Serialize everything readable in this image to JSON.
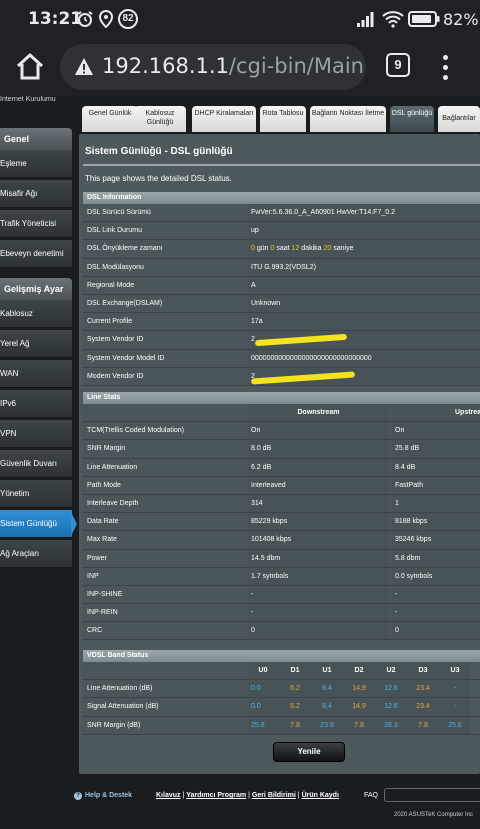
{
  "status_bar": {
    "time": "13:21",
    "notification_count": "82",
    "battery_percent": "82%"
  },
  "browser": {
    "url_host": "192.168.1.1",
    "url_path": "/cgi-bin/Main_Ac",
    "tab_count": "9"
  },
  "nav": {
    "top_text": "Internet Kurulumu",
    "section_general": "Genel",
    "general_items": [
      "Eşleme",
      "Misafir Ağı",
      "Trafik Yöneticisi",
      "Ebeveyn denetimi"
    ],
    "section_advanced": "Gelişmiş Ayar",
    "advanced_items": [
      "Kablosuz",
      "Yerel Ağ",
      "WAN",
      "IPv6",
      "VPN",
      "Güvenlik Duvarı",
      "Yönetim",
      "Sistem Günlüğü",
      "Ağ Araçları"
    ]
  },
  "tabs": [
    {
      "label": "Genel Günlük"
    },
    {
      "label": "Kablosuz Günlüğü"
    },
    {
      "label": "DHCP Kiralamaları"
    },
    {
      "label": "Rota Tablosu"
    },
    {
      "label": "Bağlantı Noktası İletme"
    },
    {
      "label": "DSL günlüğü"
    },
    {
      "label": "Bağlantılar"
    }
  ],
  "page": {
    "title": "Sistem Günlüğü - DSL günlüğü",
    "description": "This page shows the detailed DSL status."
  },
  "dsl_info": {
    "header": "DSL Information",
    "rows": [
      {
        "label": "DSL Sürücü Sürümü",
        "value": "FwVer:5.6.36.0_A_A60901 HwVer:T14.F7_0.2"
      },
      {
        "label": "DSL Link Durumu",
        "value": "up"
      },
      {
        "label": "DSL Önyükleme zamanı",
        "days": "0",
        "days_unit": "gün",
        "hours": "0",
        "hours_unit": "saat",
        "minutes": "12",
        "minutes_unit": "dakika",
        "seconds": "20",
        "seconds_unit": "saniye"
      },
      {
        "label": "DSL Modülasyonu",
        "value": "ITU G.993.2(VDSL2)"
      },
      {
        "label": "Regional Mode",
        "value": "A"
      },
      {
        "label": "DSL Exchange(DSLAM)",
        "value": "Unknown"
      },
      {
        "label": "Current Profile",
        "value": "17a"
      },
      {
        "label": "System Vendor ID",
        "value": "2"
      },
      {
        "label": "System Vendor Model ID",
        "value": "0000000000000000000000000000000"
      },
      {
        "label": "Modem Vendor ID",
        "value": "2"
      }
    ]
  },
  "line_stats": {
    "header": "Line Stats",
    "col_down": "Downstream",
    "col_up": "Upstream",
    "rows": [
      {
        "label": "TCM(Trellis Coded Modulation)",
        "down": "On",
        "up": "On"
      },
      {
        "label": "SNR Margin",
        "down": "8.0 dB",
        "up": "25.8 dB"
      },
      {
        "label": "Line Attenuation",
        "down": "6.2 dB",
        "up": "8.4 dB"
      },
      {
        "label": "Path Mode",
        "down": "Interleaved",
        "up": "FastPath"
      },
      {
        "label": "Interleave Depth",
        "down": "314",
        "up": "1"
      },
      {
        "label": "Data Rate",
        "down": "85229 kbps",
        "up": "8188 kbps"
      },
      {
        "label": "Max Rate",
        "down": "101408 kbps",
        "up": "35246 kbps"
      },
      {
        "label": "Power",
        "down": "14.5 dbm",
        "up": "5.8 dbm"
      },
      {
        "label": "INP",
        "down": "1.7 symbols",
        "up": "0.0 symbols"
      },
      {
        "label": "INP-SHINE",
        "down": "-",
        "up": "-"
      },
      {
        "label": "INP-REIN",
        "down": "-",
        "up": "-"
      },
      {
        "label": "CRC",
        "down": "0",
        "up": "0"
      }
    ]
  },
  "vdsl_band": {
    "header": "VDSL Band Status",
    "bands": [
      "U0",
      "D1",
      "U1",
      "D2",
      "U2",
      "D3",
      "U3"
    ],
    "rows": [
      {
        "label": "Line Attenuation (dB)",
        "values": [
          "0.0",
          "6.2",
          "8.4",
          "14.9",
          "12.6",
          "23.4",
          "-"
        ]
      },
      {
        "label": "Signal Attenuation (dB)",
        "values": [
          "0.0",
          "6.2",
          "8.4",
          "14.9",
          "12.6",
          "23.4",
          "-"
        ]
      },
      {
        "label": "SNR Margin (dB)",
        "values": [
          "25.8",
          "7.8",
          "23.9",
          "7.8",
          "26.3",
          "7.8",
          "25.6"
        ]
      }
    ],
    "colors": {
      "upstream": "#4fb3e8",
      "downstream": "#e8a53c"
    }
  },
  "apply_button": "Yenile",
  "footer": {
    "help": "Help & Destek",
    "links": [
      "Kılavuz",
      "Yardımcı Program",
      "Geri Bildirimi",
      "Ürün Kaydı"
    ],
    "faq": "FAQ",
    "copyright": "2020 ASUSTeK Computer Inc"
  }
}
